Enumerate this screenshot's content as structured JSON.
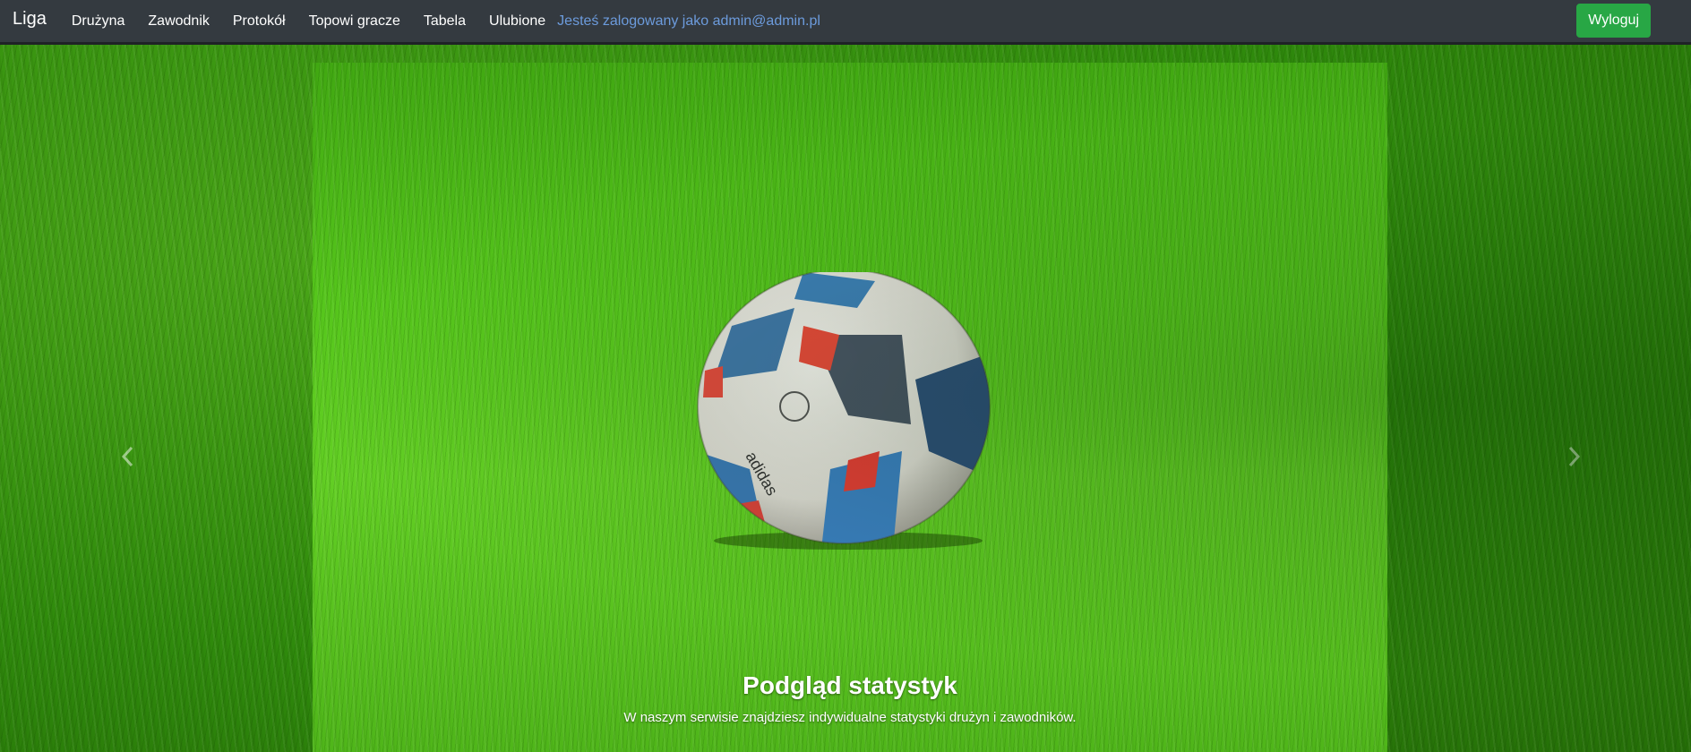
{
  "navbar": {
    "brand": "Liga",
    "links": [
      {
        "label": "Drużyna"
      },
      {
        "label": "Zawodnik"
      },
      {
        "label": "Protokół"
      },
      {
        "label": "Topowi gracze"
      },
      {
        "label": "Tabela"
      },
      {
        "label": "Ulubione"
      }
    ],
    "logged_in_text": "Jesteś zalogowany jako admin@admin.pl",
    "logout_label": "Wyloguj"
  },
  "carousel": {
    "slide_title": "Podgląd statystyk",
    "slide_text": "W naszym serwisie znajdziesz indywidualne statystyki drużyn i zawodników.",
    "prev_icon": "chevron-left-icon",
    "next_icon": "chevron-right-icon"
  },
  "colors": {
    "navbar_bg": "#343a40",
    "logout_button": "#28a745",
    "logged_in_text": "#6c9bdc",
    "grass": "#4fb51a"
  }
}
